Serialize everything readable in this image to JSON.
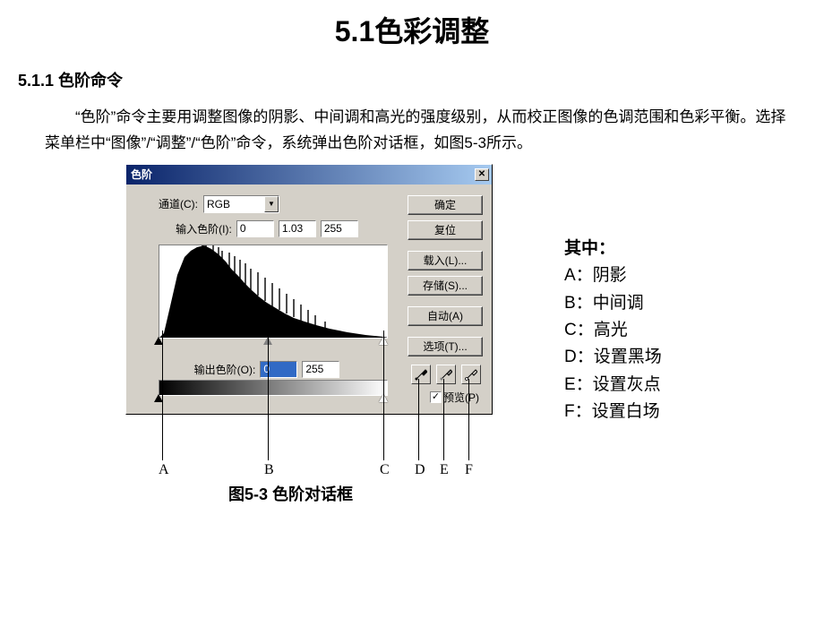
{
  "page": {
    "main_title": "5.1色彩调整",
    "section_title": "5.1.1 色阶命令",
    "paragraph": "“色阶”命令主要用调整图像的阴影、中间调和高光的强度级别，从而校正图像的色调范围和色彩平衡。选择菜单栏中“图像”/“调整”/“色阶”命令，系统弹出色阶对话框，如图5-3所示。",
    "fig_caption": "图5-3 色阶对话框"
  },
  "dialog": {
    "title": "色阶",
    "channel_label": "通道(C):",
    "channel_value": "RGB",
    "input_label": "输入色阶(I):",
    "input_shadow": "0",
    "input_gamma": "1.03",
    "input_highlight": "255",
    "output_label": "输出色阶(O):",
    "output_shadow": "0",
    "output_highlight": "255",
    "btn_ok": "确定",
    "btn_reset": "复位",
    "btn_load": "载入(L)...",
    "btn_save": "存储(S)...",
    "btn_auto": "自动(A)",
    "btn_options": "选项(T)...",
    "preview_label": "预览(P)"
  },
  "markers": {
    "A": "A",
    "B": "B",
    "C": "C",
    "D": "D",
    "E": "E",
    "F": "F"
  },
  "legend": {
    "title": "其中：",
    "A": "A：阴影",
    "B": "B：中间调",
    "C": "C：高光",
    "D": "D：设置黑场",
    "E": "E：设置灰点",
    "F": "F：设置白场"
  }
}
